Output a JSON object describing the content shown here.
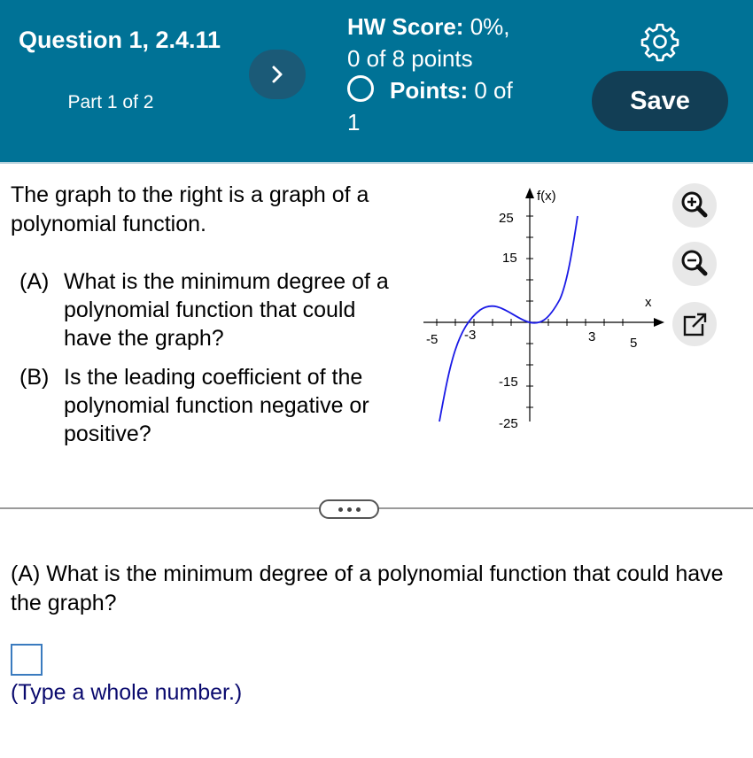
{
  "header": {
    "question_title": "Question 1, 2.4.11",
    "part": "Part 1 of 2",
    "hw_score_label": "HW Score:",
    "hw_score_value": "0%,",
    "points_total": "0 of 8 points",
    "points_label": "Points:",
    "points_value": "0 of",
    "points_value_cont": "1",
    "save_label": "Save",
    "next_icon": "chevron-right-icon",
    "settings_icon": "gear-icon"
  },
  "problem": {
    "intro": "The graph to the right is a graph of a polynomial function.",
    "questions": [
      {
        "label": "(A)",
        "text": "What is the minimum degree of a polynomial function that could have the graph?"
      },
      {
        "label": "(B)",
        "text": "Is the leading coefficient of the polynomial function negative or positive?"
      }
    ]
  },
  "graph": {
    "y_axis_label": "f(x)",
    "x_axis_label": "x",
    "x_ticks": [
      "-5",
      "-3",
      "3",
      "5"
    ],
    "y_ticks": [
      "25",
      "15",
      "-15",
      "-25"
    ],
    "curve_color": "#1a1ae6"
  },
  "tools": {
    "zoom_in_icon": "zoom-in-icon",
    "zoom_out_icon": "zoom-out-icon",
    "popout_icon": "popout-icon"
  },
  "answer": {
    "question": "(A) What is the minimum degree of a polynomial function that could have the graph?",
    "input_value": "",
    "hint": "(Type a whole number.)"
  }
}
